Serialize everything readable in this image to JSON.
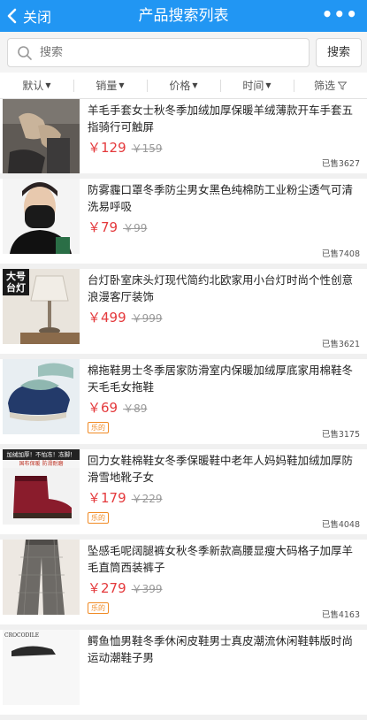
{
  "header": {
    "back_label": "关闭",
    "title": "产品搜索列表",
    "more": "•••"
  },
  "search": {
    "placeholder": "搜索",
    "button": "搜索"
  },
  "filters": [
    {
      "label": "默认",
      "icon": "arrow-down-icon"
    },
    {
      "label": "销量",
      "icon": "arrow-down-icon"
    },
    {
      "label": "价格",
      "icon": "arrow-down-icon"
    },
    {
      "label": "时间",
      "icon": "arrow-down-icon"
    },
    {
      "label": "筛选",
      "icon": "funnel-icon"
    }
  ],
  "products": [
    {
      "name": "羊毛手套女士秋冬季加绒加厚保暖羊绒薄款开车手套五指骑行可触屏",
      "price": "￥129",
      "orig": "￥159",
      "sold": "已售3627",
      "tag": ""
    },
    {
      "name": "防雾霾口罩冬季防尘男女黑色纯棉防工业粉尘透气可清洗易呼吸",
      "price": "￥79",
      "orig": "￥99",
      "sold": "已售7408",
      "tag": ""
    },
    {
      "name": "台灯卧室床头灯现代简约北欧家用小台灯时尚个性创意浪漫客厅装饰",
      "price": "￥499",
      "orig": "￥999",
      "sold": "已售3621",
      "tag": "",
      "thumb_text": "大号台灯"
    },
    {
      "name": "棉拖鞋男士冬季居家防滑室内保暖加绒厚底家用棉鞋冬天毛毛女拖鞋",
      "price": "￥69",
      "orig": "￥89",
      "sold": "已售3175",
      "tag": "乐的"
    },
    {
      "name": "回力女鞋棉鞋女冬季保暖鞋中老年人妈妈鞋加绒加厚防滑雪地靴子女",
      "price": "￥179",
      "orig": "￥229",
      "sold": "已售4048",
      "tag": "乐的",
      "thumb_banner": "加绒加厚！不怕冻！冻脚！",
      "thumb_text2": "国布保暖 防滑耐磨"
    },
    {
      "name": "坠感毛呢阔腿裤女秋冬季新款高腰显瘦大码格子加厚羊毛直筒西装裤子",
      "price": "￥279",
      "orig": "￥399",
      "sold": "已售4163",
      "tag": "乐的"
    },
    {
      "name": "鳄鱼恤男鞋冬季休闲皮鞋男士真皮潮流休闲鞋韩版时尚运动潮鞋子男",
      "price": "",
      "orig": "",
      "sold": "",
      "tag": "",
      "thumb_text": "CROCODILE"
    }
  ],
  "colors": {
    "accent": "#2196f3",
    "price": "#e4393c",
    "tag": "#f08a24"
  }
}
